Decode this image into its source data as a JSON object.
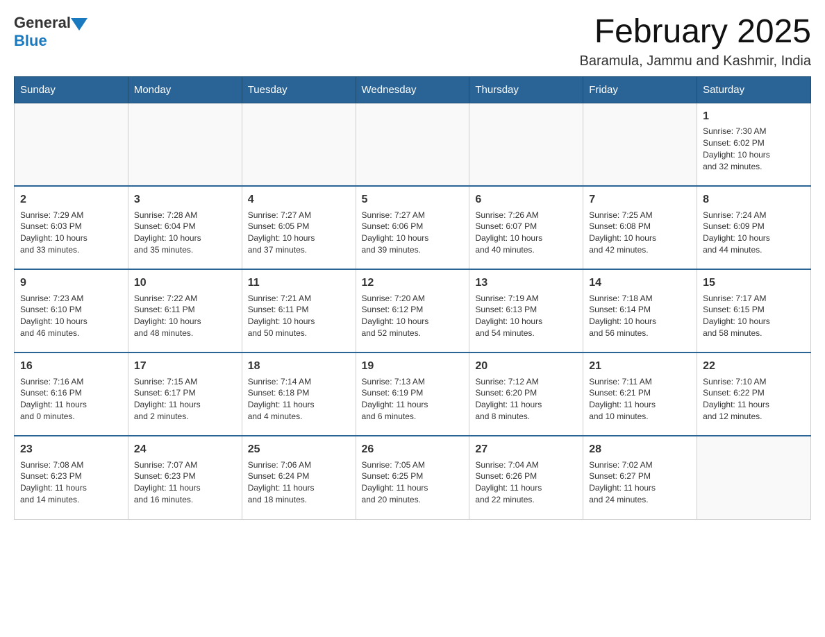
{
  "header": {
    "logo_general": "General",
    "logo_blue": "Blue",
    "month": "February 2025",
    "location": "Baramula, Jammu and Kashmir, India"
  },
  "weekdays": [
    "Sunday",
    "Monday",
    "Tuesday",
    "Wednesday",
    "Thursday",
    "Friday",
    "Saturday"
  ],
  "weeks": [
    [
      {
        "day": "",
        "info": ""
      },
      {
        "day": "",
        "info": ""
      },
      {
        "day": "",
        "info": ""
      },
      {
        "day": "",
        "info": ""
      },
      {
        "day": "",
        "info": ""
      },
      {
        "day": "",
        "info": ""
      },
      {
        "day": "1",
        "info": "Sunrise: 7:30 AM\nSunset: 6:02 PM\nDaylight: 10 hours\nand 32 minutes."
      }
    ],
    [
      {
        "day": "2",
        "info": "Sunrise: 7:29 AM\nSunset: 6:03 PM\nDaylight: 10 hours\nand 33 minutes."
      },
      {
        "day": "3",
        "info": "Sunrise: 7:28 AM\nSunset: 6:04 PM\nDaylight: 10 hours\nand 35 minutes."
      },
      {
        "day": "4",
        "info": "Sunrise: 7:27 AM\nSunset: 6:05 PM\nDaylight: 10 hours\nand 37 minutes."
      },
      {
        "day": "5",
        "info": "Sunrise: 7:27 AM\nSunset: 6:06 PM\nDaylight: 10 hours\nand 39 minutes."
      },
      {
        "day": "6",
        "info": "Sunrise: 7:26 AM\nSunset: 6:07 PM\nDaylight: 10 hours\nand 40 minutes."
      },
      {
        "day": "7",
        "info": "Sunrise: 7:25 AM\nSunset: 6:08 PM\nDaylight: 10 hours\nand 42 minutes."
      },
      {
        "day": "8",
        "info": "Sunrise: 7:24 AM\nSunset: 6:09 PM\nDaylight: 10 hours\nand 44 minutes."
      }
    ],
    [
      {
        "day": "9",
        "info": "Sunrise: 7:23 AM\nSunset: 6:10 PM\nDaylight: 10 hours\nand 46 minutes."
      },
      {
        "day": "10",
        "info": "Sunrise: 7:22 AM\nSunset: 6:11 PM\nDaylight: 10 hours\nand 48 minutes."
      },
      {
        "day": "11",
        "info": "Sunrise: 7:21 AM\nSunset: 6:11 PM\nDaylight: 10 hours\nand 50 minutes."
      },
      {
        "day": "12",
        "info": "Sunrise: 7:20 AM\nSunset: 6:12 PM\nDaylight: 10 hours\nand 52 minutes."
      },
      {
        "day": "13",
        "info": "Sunrise: 7:19 AM\nSunset: 6:13 PM\nDaylight: 10 hours\nand 54 minutes."
      },
      {
        "day": "14",
        "info": "Sunrise: 7:18 AM\nSunset: 6:14 PM\nDaylight: 10 hours\nand 56 minutes."
      },
      {
        "day": "15",
        "info": "Sunrise: 7:17 AM\nSunset: 6:15 PM\nDaylight: 10 hours\nand 58 minutes."
      }
    ],
    [
      {
        "day": "16",
        "info": "Sunrise: 7:16 AM\nSunset: 6:16 PM\nDaylight: 11 hours\nand 0 minutes."
      },
      {
        "day": "17",
        "info": "Sunrise: 7:15 AM\nSunset: 6:17 PM\nDaylight: 11 hours\nand 2 minutes."
      },
      {
        "day": "18",
        "info": "Sunrise: 7:14 AM\nSunset: 6:18 PM\nDaylight: 11 hours\nand 4 minutes."
      },
      {
        "day": "19",
        "info": "Sunrise: 7:13 AM\nSunset: 6:19 PM\nDaylight: 11 hours\nand 6 minutes."
      },
      {
        "day": "20",
        "info": "Sunrise: 7:12 AM\nSunset: 6:20 PM\nDaylight: 11 hours\nand 8 minutes."
      },
      {
        "day": "21",
        "info": "Sunrise: 7:11 AM\nSunset: 6:21 PM\nDaylight: 11 hours\nand 10 minutes."
      },
      {
        "day": "22",
        "info": "Sunrise: 7:10 AM\nSunset: 6:22 PM\nDaylight: 11 hours\nand 12 minutes."
      }
    ],
    [
      {
        "day": "23",
        "info": "Sunrise: 7:08 AM\nSunset: 6:23 PM\nDaylight: 11 hours\nand 14 minutes."
      },
      {
        "day": "24",
        "info": "Sunrise: 7:07 AM\nSunset: 6:23 PM\nDaylight: 11 hours\nand 16 minutes."
      },
      {
        "day": "25",
        "info": "Sunrise: 7:06 AM\nSunset: 6:24 PM\nDaylight: 11 hours\nand 18 minutes."
      },
      {
        "day": "26",
        "info": "Sunrise: 7:05 AM\nSunset: 6:25 PM\nDaylight: 11 hours\nand 20 minutes."
      },
      {
        "day": "27",
        "info": "Sunrise: 7:04 AM\nSunset: 6:26 PM\nDaylight: 11 hours\nand 22 minutes."
      },
      {
        "day": "28",
        "info": "Sunrise: 7:02 AM\nSunset: 6:27 PM\nDaylight: 11 hours\nand 24 minutes."
      },
      {
        "day": "",
        "info": ""
      }
    ]
  ]
}
